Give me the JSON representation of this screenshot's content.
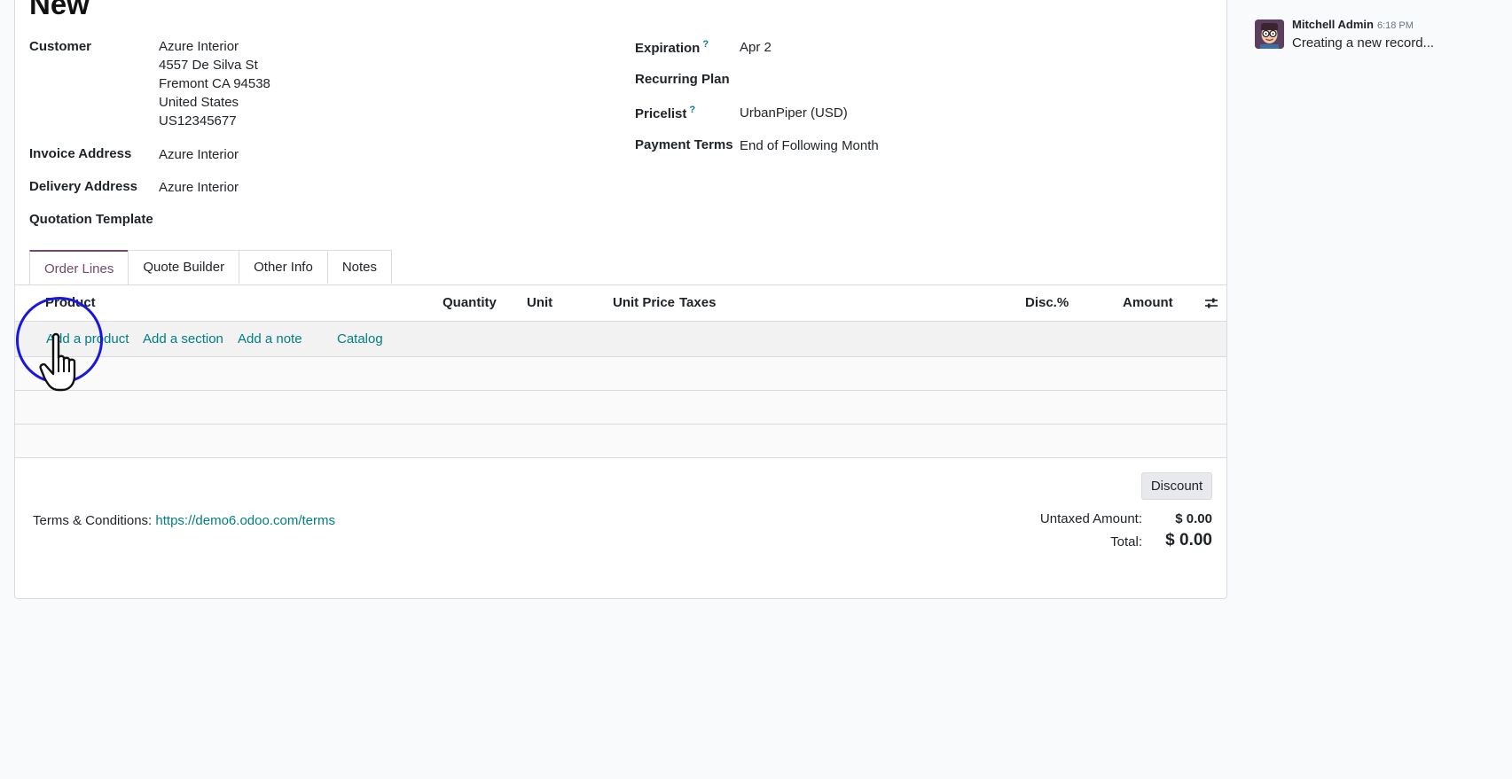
{
  "page": {
    "title": "New"
  },
  "form": {
    "customer_label": "Customer",
    "customer_lines": [
      "Azure Interior",
      "4557 De Silva St",
      "Fremont CA 94538",
      "United States",
      "US12345677"
    ],
    "invoice_address_label": "Invoice Address",
    "invoice_address_value": "Azure Interior",
    "delivery_address_label": "Delivery Address",
    "delivery_address_value": "Azure Interior",
    "quotation_template_label": "Quotation Template",
    "expiration_label": "Expiration",
    "expiration_value": "Apr 2",
    "recurring_plan_label": "Recurring Plan",
    "pricelist_label": "Pricelist",
    "pricelist_value": "UrbanPiper (USD)",
    "payment_terms_label": "Payment Terms",
    "payment_terms_value": "End of Following Month",
    "help_mark": "?"
  },
  "tabs": [
    "Order Lines",
    "Quote Builder",
    "Other Info",
    "Notes"
  ],
  "table": {
    "columns": [
      "Product",
      "Quantity",
      "Unit",
      "Unit Price",
      "Taxes",
      "Disc.%",
      "Amount"
    ],
    "actions": [
      "Add a product",
      "Add a section",
      "Add a note",
      "Catalog"
    ]
  },
  "footer": {
    "terms_label": "Terms & Conditions:",
    "terms_link": "https://demo6.odoo.com/terms",
    "discount_button": "Discount",
    "untaxed_label": "Untaxed Amount:",
    "untaxed_value": "$ 0.00",
    "total_label": "Total:",
    "total_value": "$ 0.00"
  },
  "chatter": {
    "author": "Mitchell Admin",
    "time": "6:18 PM",
    "message": "Creating a new record..."
  },
  "colors": {
    "accent": "#714b67",
    "link": "#017e84",
    "cursor_ring": "#1717e0"
  },
  "icons": {
    "column_settings": "sliders-icon",
    "avatar": "user-avatar",
    "cursor": "hand-pointer-icon"
  }
}
